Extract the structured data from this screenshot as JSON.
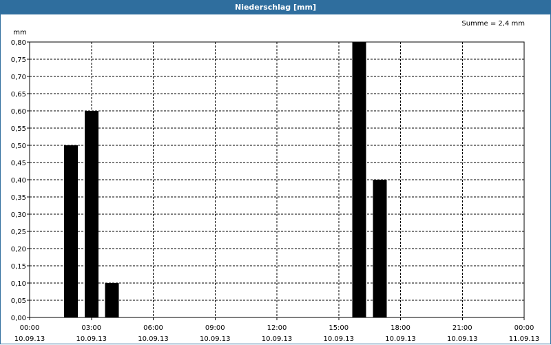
{
  "window": {
    "title": "Niederschlag [mm]"
  },
  "colors": {
    "titlebar": "#2f6e9e",
    "bar": "#000000",
    "grid": "#000000"
  },
  "chart_data": {
    "type": "bar",
    "title": "Niederschlag [mm]",
    "ylabel": "mm",
    "ylim": [
      0,
      0.8
    ],
    "y_ticks": [
      "0,00",
      "0,05",
      "0,10",
      "0,15",
      "0,20",
      "0,25",
      "0,30",
      "0,35",
      "0,40",
      "0,45",
      "0,50",
      "0,55",
      "0,60",
      "0,65",
      "0,70",
      "0,75",
      "0,80"
    ],
    "x_range_hours": [
      0,
      24
    ],
    "x_ticks": [
      {
        "time": "00:00",
        "date": "10.09.13"
      },
      {
        "time": "03:00",
        "date": "10.09.13"
      },
      {
        "time": "06:00",
        "date": "10.09.13"
      },
      {
        "time": "09:00",
        "date": "10.09.13"
      },
      {
        "time": "12:00",
        "date": "10.09.13"
      },
      {
        "time": "15:00",
        "date": "10.09.13"
      },
      {
        "time": "18:00",
        "date": "10.09.13"
      },
      {
        "time": "21:00",
        "date": "10.09.13"
      },
      {
        "time": "00:00",
        "date": "11.09.13"
      }
    ],
    "bars": [
      {
        "hour": 2,
        "value": 0.5
      },
      {
        "hour": 3,
        "value": 0.6
      },
      {
        "hour": 4,
        "value": 0.1
      },
      {
        "hour": 16,
        "value": 0.8
      },
      {
        "hour": 17,
        "value": 0.4
      }
    ],
    "annotation": "Summe = 2,4 mm",
    "grid": true,
    "legend": "none"
  }
}
